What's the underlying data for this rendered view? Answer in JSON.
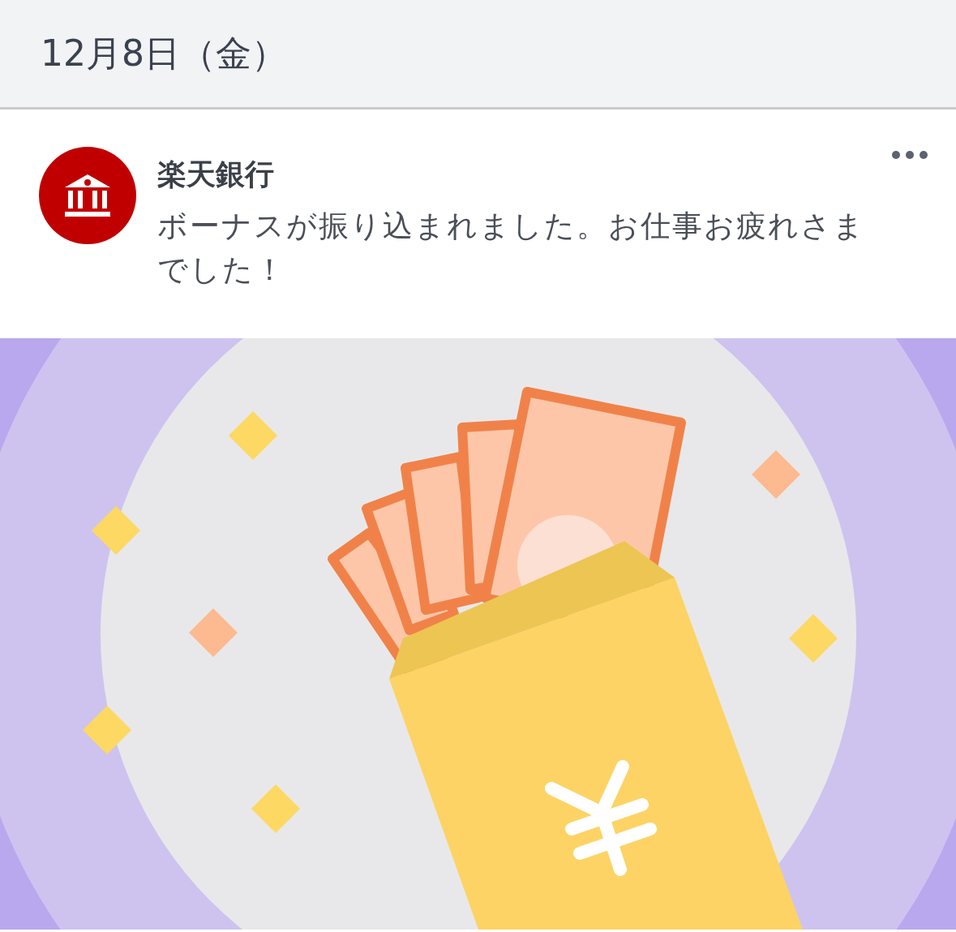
{
  "date_header": {
    "date": "12月8日（金）"
  },
  "notification": {
    "sender": "楽天銀行",
    "message": "ボーナスが振り込まれました。お仕事お疲れさまでした！"
  },
  "image": {
    "kind": "illustration"
  }
}
